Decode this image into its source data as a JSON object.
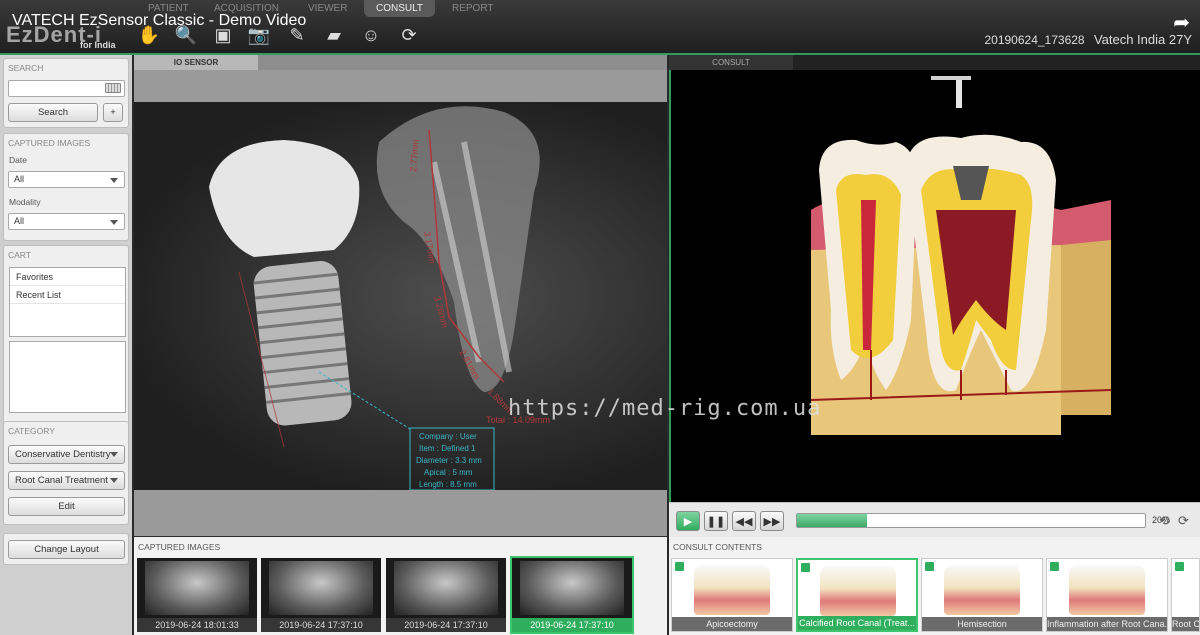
{
  "video_title": "VATECH EzSensor Classic - Demo Video",
  "logo": {
    "text": "EzDent-i",
    "sub": "for India"
  },
  "tabs": [
    "PATIENT",
    "ACQUISITION",
    "VIEWER",
    "CONSULT",
    "REPORT"
  ],
  "session": {
    "id": "20190624_173628",
    "patient": "Vatech India 27Y"
  },
  "sidebar": {
    "search": {
      "title": "SEARCH",
      "value": "",
      "button": "Search",
      "add": "+"
    },
    "captured": {
      "title": "CAPTURED IMAGES",
      "date_label": "Date",
      "date_value": "All",
      "modality_label": "Modality",
      "modality_value": "All"
    },
    "cart": {
      "title": "CART",
      "items": [
        "Favorites",
        "Recent List"
      ]
    },
    "category": {
      "title": "CATEGORY",
      "primary": "Conservative Dentistry",
      "secondary": "Root Canal Treatment",
      "edit": "Edit"
    },
    "change_layout": "Change Layout"
  },
  "viewer": {
    "label": "IO SENSOR",
    "measurements": [
      "2.77mm",
      "3.17mm",
      "3.26mm",
      "2.81mm",
      "1.88mm",
      "Total : 14.09mm"
    ],
    "implant_info": [
      "Company : User",
      "Item : Defined 1",
      "Diameter : 3.3 mm",
      "Apical : 5 mm",
      "Length : 8.5 mm"
    ]
  },
  "consult": {
    "label": "CONSULT",
    "progress_percent": 20,
    "progress_text": "20%"
  },
  "watermark": "https://med-rig.com.ua",
  "captured_strip": {
    "title": "CAPTURED IMAGES",
    "items": [
      {
        "label": "2019-06-24 18:01:33",
        "selected": false
      },
      {
        "label": "2019-06-24 17:37:10",
        "selected": false
      },
      {
        "label": "2019-06-24 17:37:10",
        "selected": false
      },
      {
        "label": "2019-06-24 17:37:10",
        "selected": true
      }
    ]
  },
  "consult_strip": {
    "title": "CONSULT CONTENTS",
    "items": [
      {
        "label": "Apicoectomy",
        "selected": false
      },
      {
        "label": "Calcified Root Canal (Treat...",
        "selected": true
      },
      {
        "label": "Hemisection",
        "selected": false
      },
      {
        "label": "Inflammation after Root Cana...",
        "selected": false
      },
      {
        "label": "Root C...",
        "selected": false
      }
    ]
  },
  "colors": {
    "accent": "#2fae5d",
    "measure": "#b03838",
    "info": "#38b6c8"
  }
}
